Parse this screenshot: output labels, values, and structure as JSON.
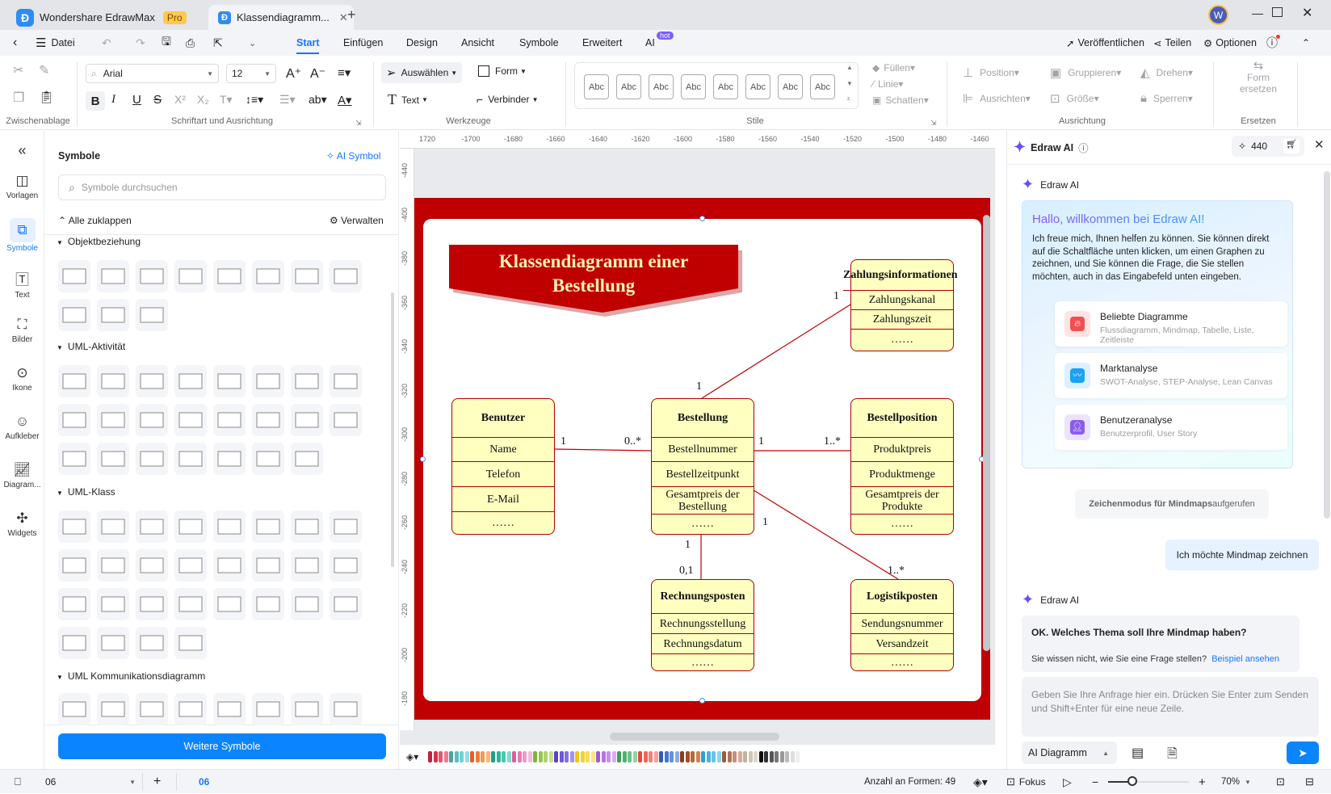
{
  "titlebar": {
    "app_name": "Wondershare EdrawMax",
    "app_badge": "Pro",
    "doc_tab": "Klassendiagramm...",
    "avatar_letter": "W"
  },
  "menubar": {
    "file": "Datei",
    "tabs": [
      "Start",
      "Einfügen",
      "Design",
      "Ansicht",
      "Symbole",
      "Erweitert",
      "AI"
    ],
    "ai_badge": "hot",
    "publish": "Veröffentlichen",
    "share": "Teilen",
    "options": "Optionen"
  },
  "ribbon": {
    "font_name": "Arial",
    "font_size": "12",
    "select": "Auswählen",
    "shape": "Form",
    "text": "Text",
    "connector": "Verbinder",
    "style_sample": "Abc",
    "fill": "Füllen",
    "line": "Linie",
    "shadow": "Schatten",
    "position": "Position",
    "group": "Gruppieren",
    "rotate": "Drehen",
    "align": "Ausrichten",
    "size": "Größe",
    "lock": "Sperren",
    "replace_shape_1": "Form",
    "replace_shape_2": "ersetzen",
    "groups": [
      "Zwischenablage",
      "Schriftart und Ausrichtung",
      "Werkzeuge",
      "Stile",
      "Ausrichtung",
      "Ersetzen"
    ]
  },
  "leftrail": {
    "items": [
      "Vorlagen",
      "Symbole",
      "Text",
      "Bilder",
      "Ikone",
      "Aufkleber",
      "Diagram...",
      "Widgets"
    ]
  },
  "symbols": {
    "title": "Symbole",
    "ai_symbol": "AI Symbol",
    "search_placeholder": "Symbole durchsuchen",
    "collapse_all": "Alle zuklappen",
    "manage": "Verwalten",
    "sections": [
      "Objektbeziehung",
      "UML-Aktivität",
      "UML-Klass",
      "UML Kommunikationsdiagramm"
    ],
    "more_button": "Weitere Symbole"
  },
  "ruler": {
    "h": [
      "1720",
      "-1700",
      "-1680",
      "-1660",
      "-1640",
      "-1620",
      "-1600",
      "-1580",
      "-1560",
      "-1540",
      "-1520",
      "-1500",
      "-1480",
      "-1460"
    ],
    "v": [
      "-440",
      "-400",
      "-380",
      "-360",
      "-340",
      "-320",
      "-300",
      "-280",
      "-260",
      "-240",
      "-220",
      "-200",
      "-180"
    ]
  },
  "diagram": {
    "title_line1": "Klassendiagramm einer",
    "title_line2": "Bestellung",
    "classes": {
      "zahlung": {
        "name": "Zahlungsinformationen",
        "rows": [
          "Zahlungskanal",
          "Zahlungszeit",
          "……"
        ]
      },
      "benutzer": {
        "name": "Benutzer",
        "rows": [
          "Name",
          "Telefon",
          "E-Mail",
          "……"
        ]
      },
      "bestellung": {
        "name": "Bestellung",
        "rows": [
          "Bestellnummer",
          "Bestellzeitpunkt",
          "Gesamtpreis der Bestellung",
          "……"
        ]
      },
      "position": {
        "name": "Bestellposition",
        "rows": [
          "Produktpreis",
          "Produktmenge",
          "Gesamtpreis der Produkte",
          "……"
        ]
      },
      "rechnung": {
        "name": "Rechnungsposten",
        "rows": [
          "Rechnungsstellung",
          "Rechnungsdatum",
          "……"
        ]
      },
      "logistik": {
        "name": "Logistikposten",
        "rows": [
          "Sendungsnummer",
          "Versandzeit",
          "……"
        ]
      }
    },
    "multiplicities": {
      "zahlung_end": "1",
      "bestellung_top": "1",
      "benutzer_end": "1",
      "bestellung_left": "0..*",
      "bestellung_right": "1",
      "position_end": "1..*",
      "bestellung_bottom": "1",
      "rechnung_end": "0,1",
      "bestellung_diag": "1",
      "logistik_end": "1..*"
    }
  },
  "ai": {
    "header": "Edraw AI",
    "credits": "440",
    "bot_name": "Edraw AI",
    "welcome_title": "Hallo, willkommen bei Edraw AI!",
    "welcome_text": "Ich freue mich, Ihnen helfen zu können. Sie können direkt auf die Schaltfläche unten klicken, um einen Graphen zu zeichnen, und Sie können die Frage, die Sie stellen möchten, auch in das Eingabefeld unten eingeben.",
    "cards": [
      {
        "title": "Beliebte Diagramme",
        "sub": "Flussdiagramm, Mindmap, Tabelle, Liste, Zeitleiste"
      },
      {
        "title": "Marktanalyse",
        "sub": "SWOT-Analyse, STEP-Analyse, Lean Canvas"
      },
      {
        "title": "Benutzeranalyse",
        "sub": "Benutzerprofil, User Story"
      }
    ],
    "mode_notice_bold": "Zeichenmodus für Mindmaps",
    "mode_notice_rest": " aufgerufen",
    "user_msg": "Ich möchte Mindmap zeichnen",
    "bot_question": "OK. Welches Thema soll Ihre Mindmap haben?",
    "hint": "Sie wissen nicht, wie Sie eine Frage stellen?",
    "hint_link": "Beispiel ansehen",
    "input_placeholder": "Geben Sie Ihre Anfrage hier ein. Drücken Sie Enter zum Senden und Shift+Enter für eine neue Zeile.",
    "mode_select": "AI Diagramm"
  },
  "status": {
    "page_select": "06",
    "page_tab": "06",
    "shape_count": "Anzahl an Formen: 49",
    "focus": "Fokus",
    "zoom": "70%",
    "zoom_level": 0.3
  },
  "colors": {
    "accent": "#1677ff",
    "diagram_red": "#c00000",
    "class_fill": "#ffffc0",
    "title_text": "#fff2b0"
  }
}
